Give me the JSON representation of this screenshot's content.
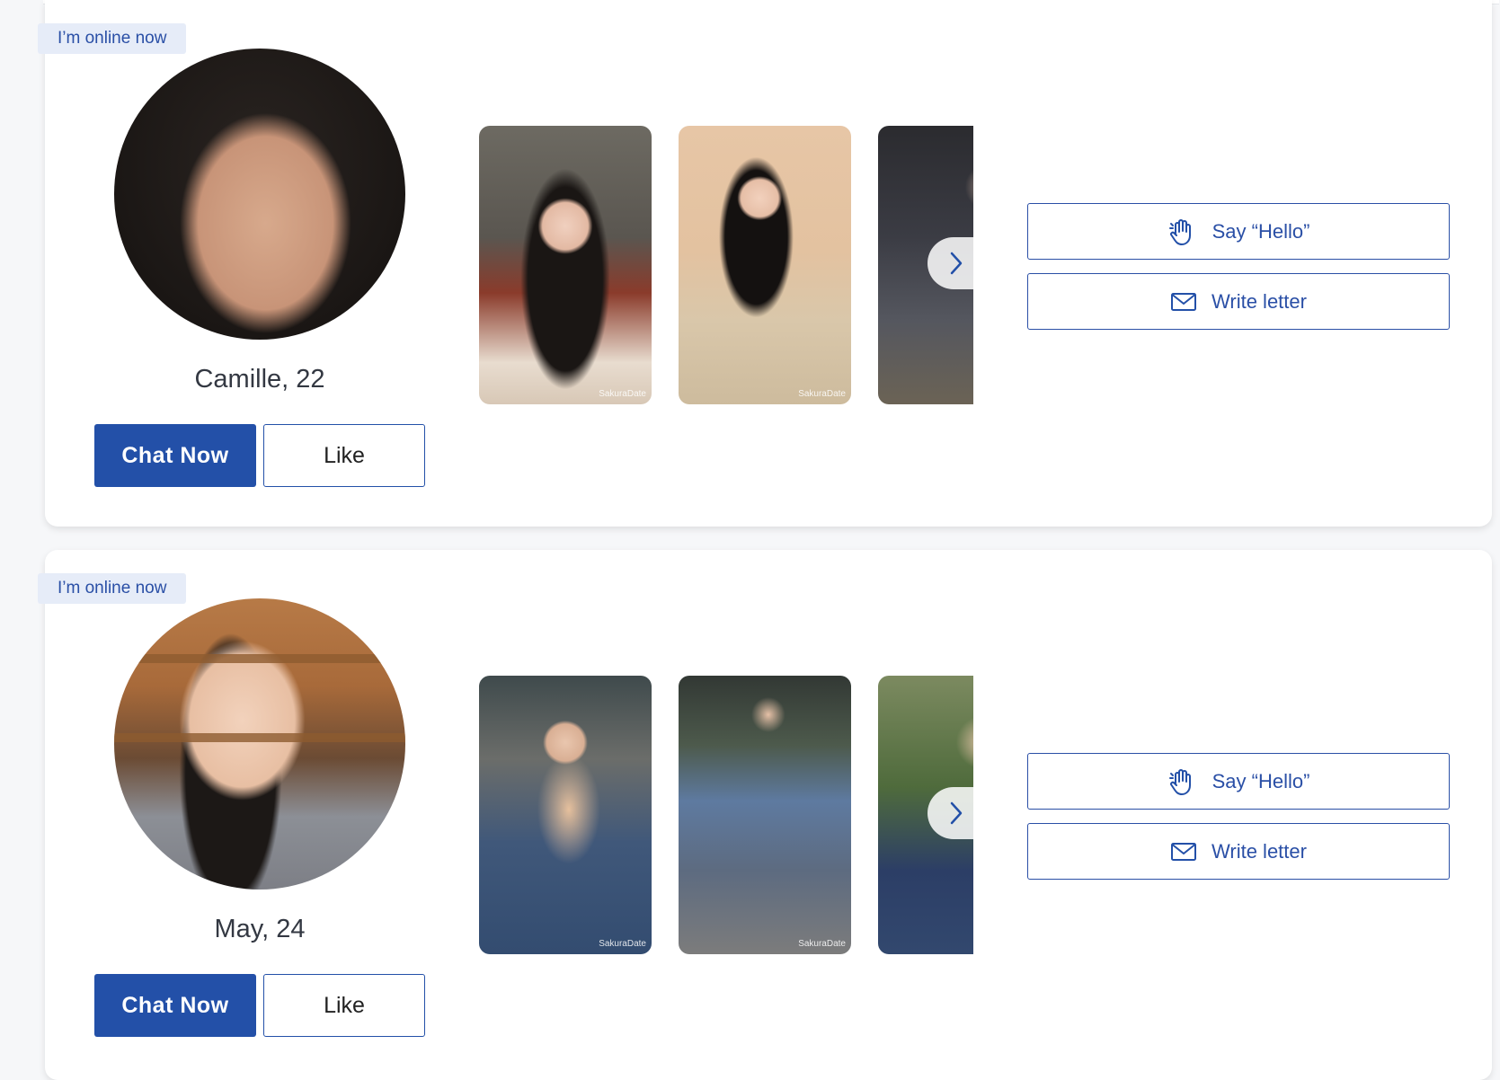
{
  "profiles": [
    {
      "status": "I’m online now",
      "name_age": "Camille, 22",
      "chat_label": "Chat Now",
      "like_label": "Like",
      "hello_label": "Say “Hello”",
      "letter_label": "Write letter",
      "watermark": "SakuraDate"
    },
    {
      "status": "I’m online now",
      "name_age": "May, 24",
      "chat_label": "Chat Now",
      "like_label": "Like",
      "hello_label": "Say “Hello”",
      "letter_label": "Write letter",
      "watermark": "SakuraDate"
    }
  ],
  "colors": {
    "brand_blue": "#2350a8",
    "badge_bg": "#e6ecf8",
    "name_text": "#333842"
  },
  "icons": {
    "hello": "waving-hand-icon",
    "letter": "envelope-icon",
    "next": "chevron-right-icon"
  }
}
